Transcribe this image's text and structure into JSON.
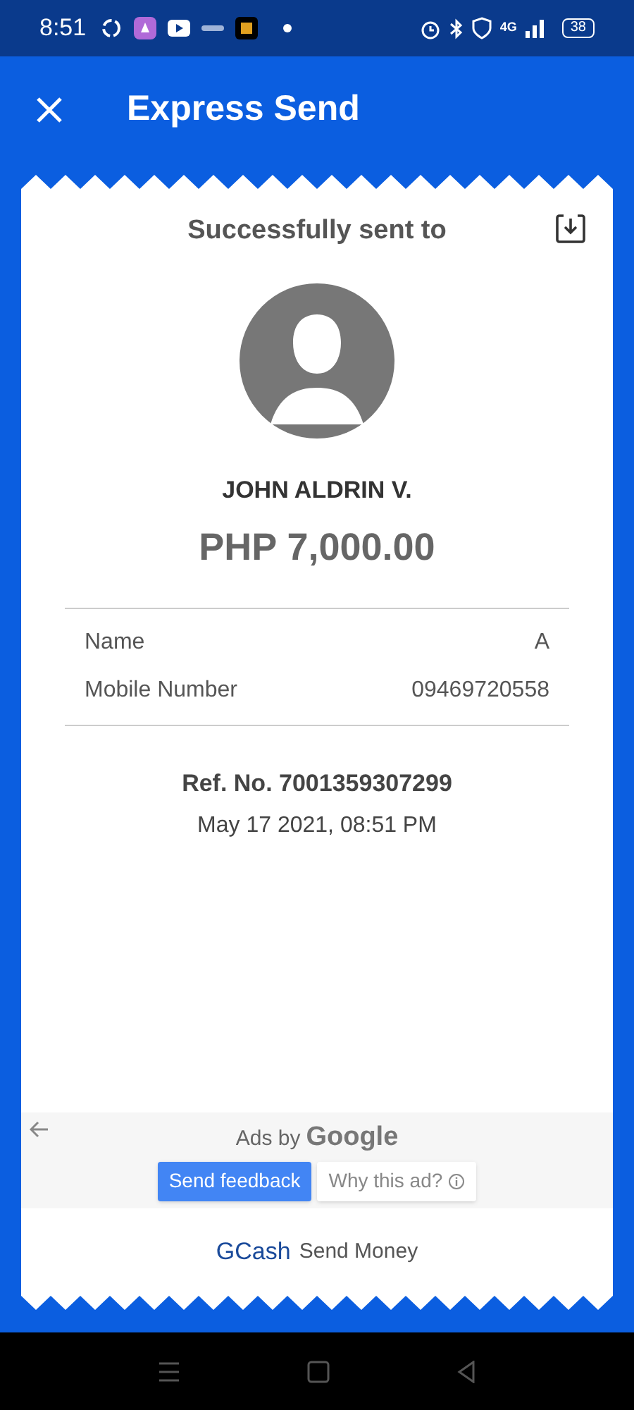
{
  "status_bar": {
    "time": "8:51",
    "network": "4G",
    "battery": "38"
  },
  "header": {
    "title": "Express Send"
  },
  "receipt": {
    "heading": "Successfully sent to",
    "recipient": "JOHN ALDRIN V.",
    "amount": "PHP 7,000.00",
    "details": [
      {
        "label": "Name",
        "value": "A"
      },
      {
        "label": "Mobile Number",
        "value": "09469720558"
      }
    ],
    "reference": "Ref. No. 7001359307299",
    "date": "May 17 2021, 08:51 PM"
  },
  "ad": {
    "attribution": "Ads by",
    "brand": "Google",
    "feedback_button": "Send feedback",
    "why_button": "Why this ad?"
  },
  "footer": {
    "brand": "GCash",
    "label": "Send Money"
  }
}
